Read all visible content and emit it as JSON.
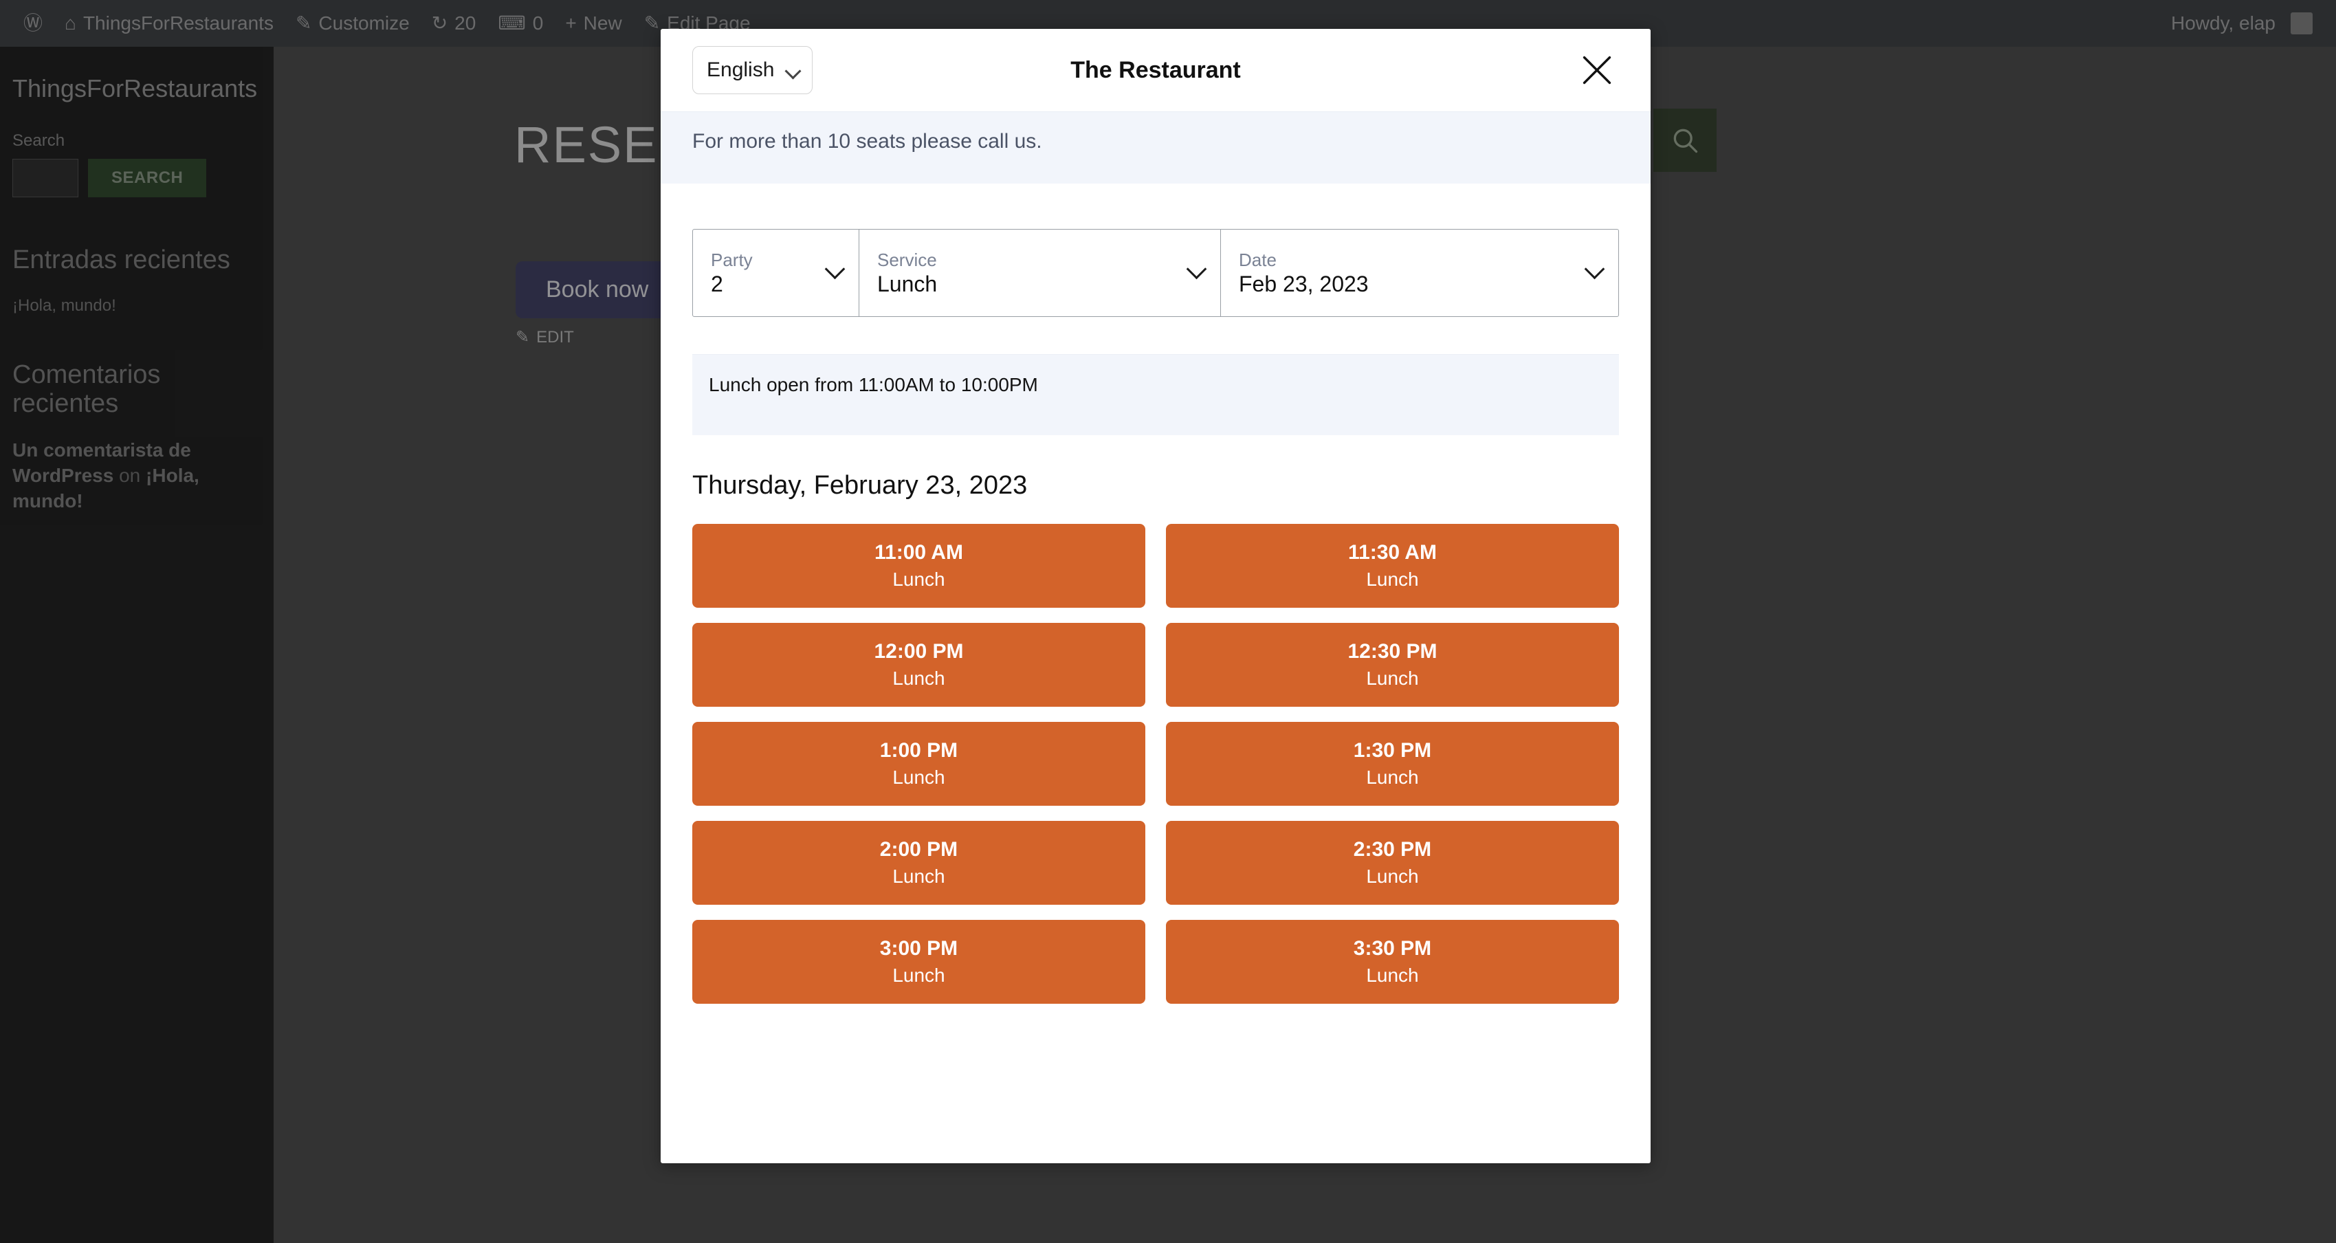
{
  "admin_bar": {
    "items": [
      {
        "icon": "wordpress-logo-icon",
        "glyph": "Ⓦ",
        "label": ""
      },
      {
        "icon": "home-icon",
        "glyph": "⌂",
        "label": "ThingsForRestaurants"
      },
      {
        "icon": "customize-icon",
        "glyph": "✎",
        "label": "Customize"
      },
      {
        "icon": "update-icon",
        "glyph": "↻",
        "label": "20"
      },
      {
        "icon": "comment-icon",
        "glyph": "⌨",
        "label": "0"
      },
      {
        "icon": "plus-icon",
        "glyph": "+",
        "label": "New"
      },
      {
        "icon": "edit-page-icon",
        "glyph": "✎",
        "label": "Edit Page"
      }
    ],
    "greeting": "Howdy, elap"
  },
  "sidebar": {
    "site_title": "ThingsForRestaurants",
    "search_label": "Search",
    "search_value": "",
    "search_button": "SEARCH",
    "recent_posts_heading": "Entradas recientes",
    "recent_posts": [
      "¡Hola, mundo!"
    ],
    "recent_comments_heading": "Comentarios recientes",
    "recent_comments": [
      {
        "author": "Un comentarista de WordPress",
        "connector": "on",
        "post": "¡Hola, mundo!"
      }
    ]
  },
  "page": {
    "heading": "RESERVATIONS",
    "book_now_label": "Book now",
    "edit_label": "EDIT",
    "search_icon": "search-icon"
  },
  "modal": {
    "language": {
      "selected": "English",
      "options": [
        "English"
      ]
    },
    "title": "The Restaurant",
    "close_icon": "close-icon",
    "notice": "For more than 10 seats please call us.",
    "fields": {
      "party": {
        "label": "Party",
        "value": "2"
      },
      "service": {
        "label": "Service",
        "value": "Lunch"
      },
      "date": {
        "label": "Date",
        "value": "Feb 23, 2023"
      }
    },
    "hours_notice": "Lunch open from 11:00AM to 10:00PM",
    "day_heading": "Thursday, February 23, 2023",
    "slot_color": "#d3632a",
    "slots": [
      {
        "time": "11:00 AM",
        "service": "Lunch"
      },
      {
        "time": "11:30 AM",
        "service": "Lunch"
      },
      {
        "time": "12:00 PM",
        "service": "Lunch"
      },
      {
        "time": "12:30 PM",
        "service": "Lunch"
      },
      {
        "time": "1:00 PM",
        "service": "Lunch"
      },
      {
        "time": "1:30 PM",
        "service": "Lunch"
      },
      {
        "time": "2:00 PM",
        "service": "Lunch"
      },
      {
        "time": "2:30 PM",
        "service": "Lunch"
      },
      {
        "time": "3:00 PM",
        "service": "Lunch"
      },
      {
        "time": "3:30 PM",
        "service": "Lunch"
      }
    ]
  }
}
